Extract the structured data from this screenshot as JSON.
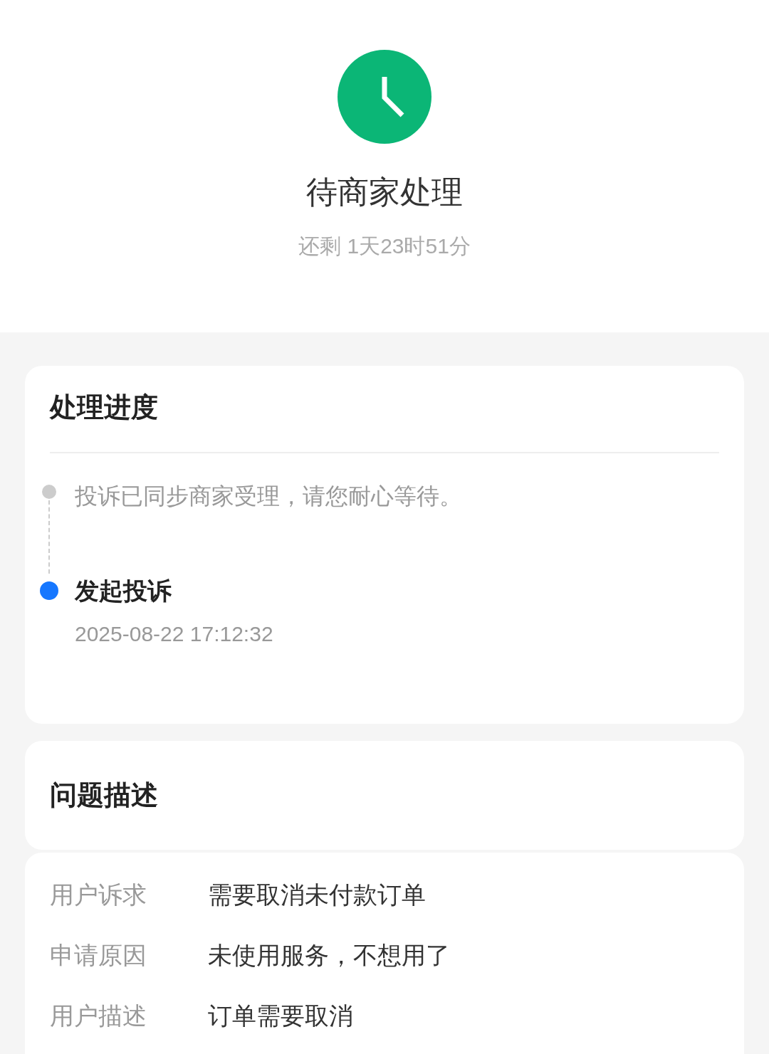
{
  "status": {
    "title": "待商家处理",
    "countdown": "还剩 1天23时51分"
  },
  "progress": {
    "title": "处理进度",
    "steps": [
      {
        "text": "投诉已同步商家受理，请您耐心等待。",
        "active": false
      },
      {
        "title": "发起投诉",
        "time": "2025-08-22 17:12:32",
        "active": true
      }
    ]
  },
  "issue": {
    "title": "问题描述",
    "details": [
      {
        "label": "用户诉求",
        "value": "需要取消未付款订单"
      },
      {
        "label": "申请原因",
        "value": "未使用服务，不想用了"
      },
      {
        "label": "用户描述",
        "value": "订单需要取消"
      }
    ]
  }
}
